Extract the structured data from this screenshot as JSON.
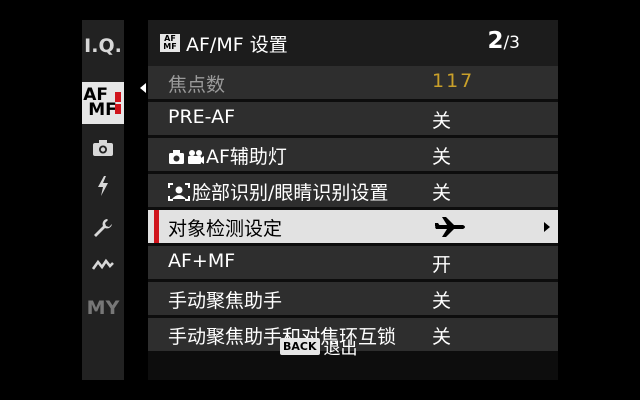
{
  "sidebar": {
    "items": [
      {
        "label": "I.Q."
      },
      {
        "label_line1": "AF",
        "label_line2": "MF"
      },
      {
        "icon": "camera-icon"
      },
      {
        "icon": "flash-icon"
      },
      {
        "icon": "wrench-icon"
      },
      {
        "icon": "connection-icon"
      },
      {
        "label": "MY"
      }
    ]
  },
  "header": {
    "icon_text_1": "AF",
    "icon_text_2": "MF",
    "title": "AF/MF 设置",
    "page_current": "2",
    "page_total": "/3"
  },
  "menu": {
    "rows": [
      {
        "label": "焦点数",
        "value": "117"
      },
      {
        "label": "PRE-AF",
        "value": "关"
      },
      {
        "label": "AF辅助灯",
        "value": "关"
      },
      {
        "label": "脸部识别/眼睛识别设置",
        "value": "关"
      },
      {
        "label": "对象检测设定",
        "value_icon": "airplane-icon"
      },
      {
        "label": "AF+MF",
        "value": "开"
      },
      {
        "label": "手动聚焦助手",
        "value": "关"
      },
      {
        "label": "手动聚焦助手和对焦环互锁",
        "value": "关"
      }
    ]
  },
  "footer": {
    "back_label": "BACK",
    "exit_label": "退出"
  },
  "colors": {
    "accent_red": "#d0141c",
    "value_gold": "#c9a02a",
    "selected_bg": "#e2e2e2"
  }
}
